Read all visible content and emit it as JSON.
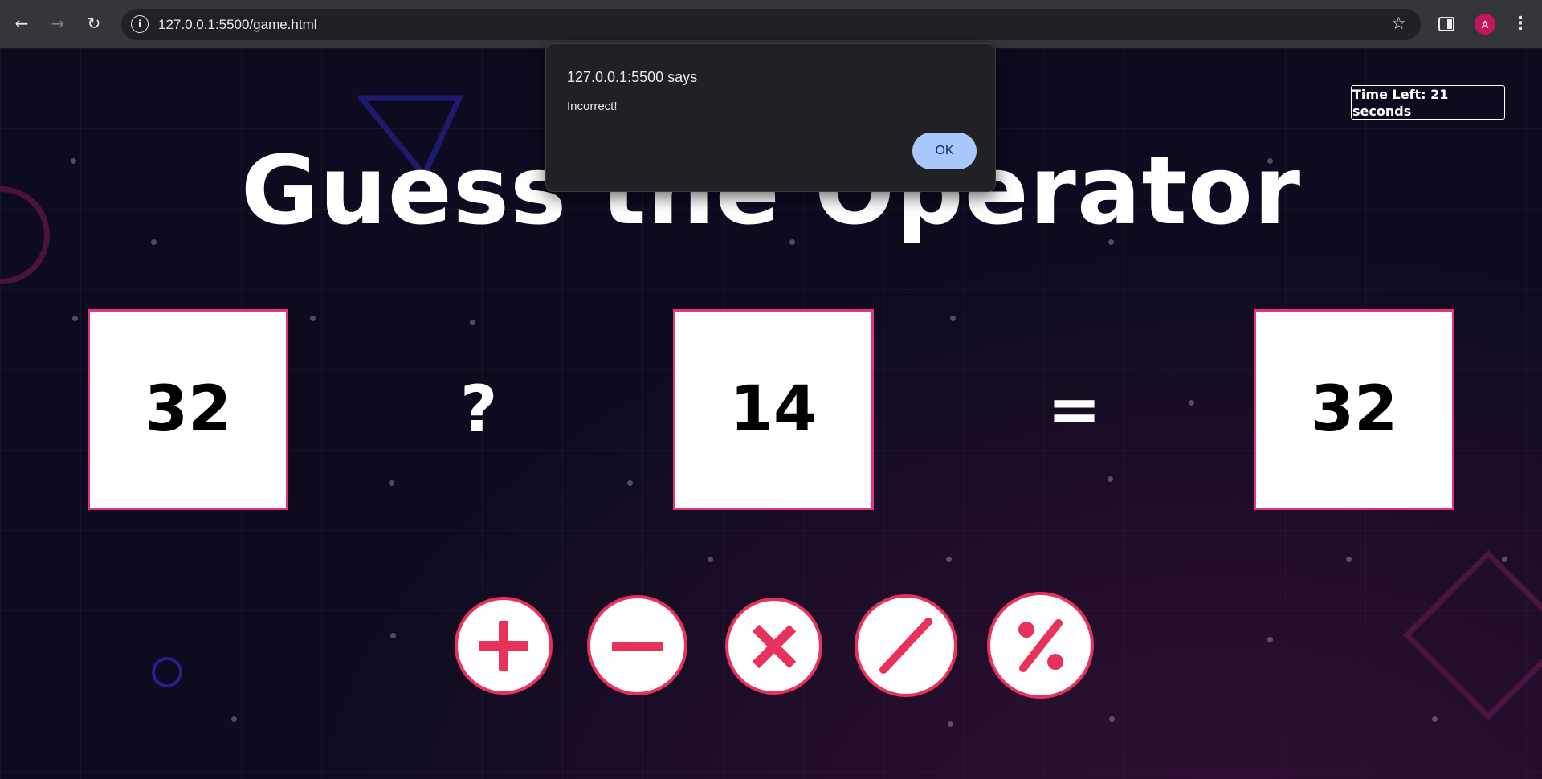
{
  "browser": {
    "url": "127.0.0.1:5500/game.html",
    "back_glyph": "←",
    "forward_glyph": "→",
    "reload_glyph": "↻",
    "site_info_glyph": "i",
    "star_glyph": "☆",
    "avatar_initial": "A",
    "menu_glyph": "⋮"
  },
  "game": {
    "title": "Guess the Operator",
    "timer_text": "Time Left: 21 seconds",
    "operand_left": "32",
    "operator_placeholder": "?",
    "operand_right": "14",
    "equals": "=",
    "result": "32",
    "operator_buttons": [
      {
        "name": "plus",
        "icon": "plus-icon"
      },
      {
        "name": "minus",
        "icon": "minus-icon"
      },
      {
        "name": "multiply",
        "icon": "times-icon"
      },
      {
        "name": "divide",
        "icon": "slash-icon"
      },
      {
        "name": "modulo",
        "icon": "percent-icon"
      }
    ]
  },
  "dialog": {
    "title": "127.0.0.1:5500 says",
    "message": "Incorrect!",
    "ok_label": "OK"
  },
  "colors": {
    "accent": "#e8325b",
    "box_border": "#e8327c",
    "background": "#0d0b1f",
    "dialog_button": "#a8c7fa"
  }
}
